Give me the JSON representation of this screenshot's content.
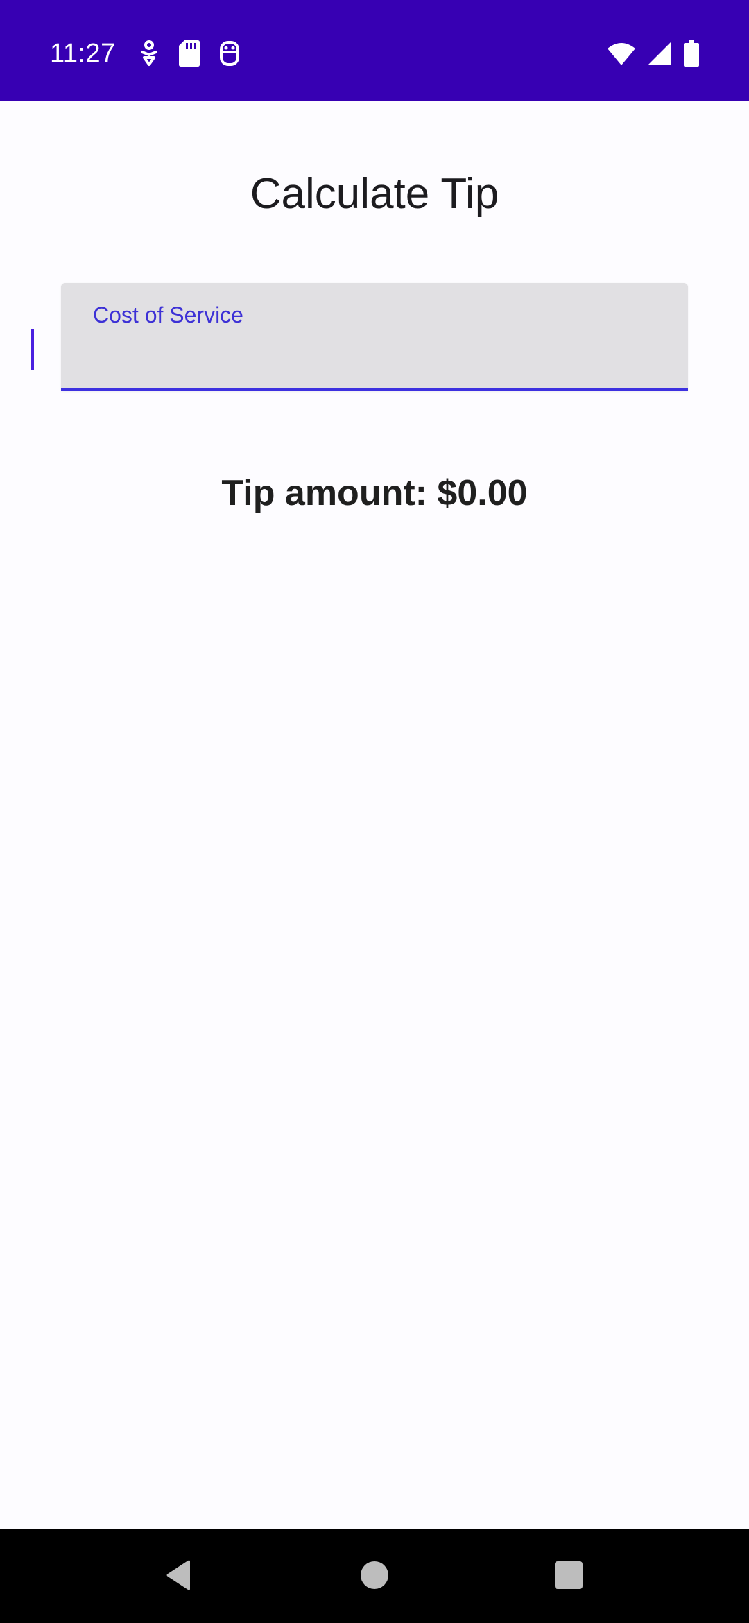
{
  "status_bar": {
    "time": "11:27",
    "left_icons": [
      "accessibility-icon",
      "sd-card-icon",
      "robot-icon"
    ],
    "right_icons": [
      "wifi-icon",
      "cell-signal-icon",
      "battery-icon"
    ],
    "background": "#3700b3"
  },
  "main": {
    "title": "Calculate Tip",
    "cost_field": {
      "label": "Cost of Service",
      "value": ""
    },
    "tip_amount": "Tip amount: $0.00"
  },
  "nav_bar": {
    "buttons": [
      "back",
      "home",
      "recents"
    ]
  },
  "colors": {
    "accent": "#3d31e0",
    "field_background": "#e1e0e3",
    "page_background": "#fdfcff"
  }
}
